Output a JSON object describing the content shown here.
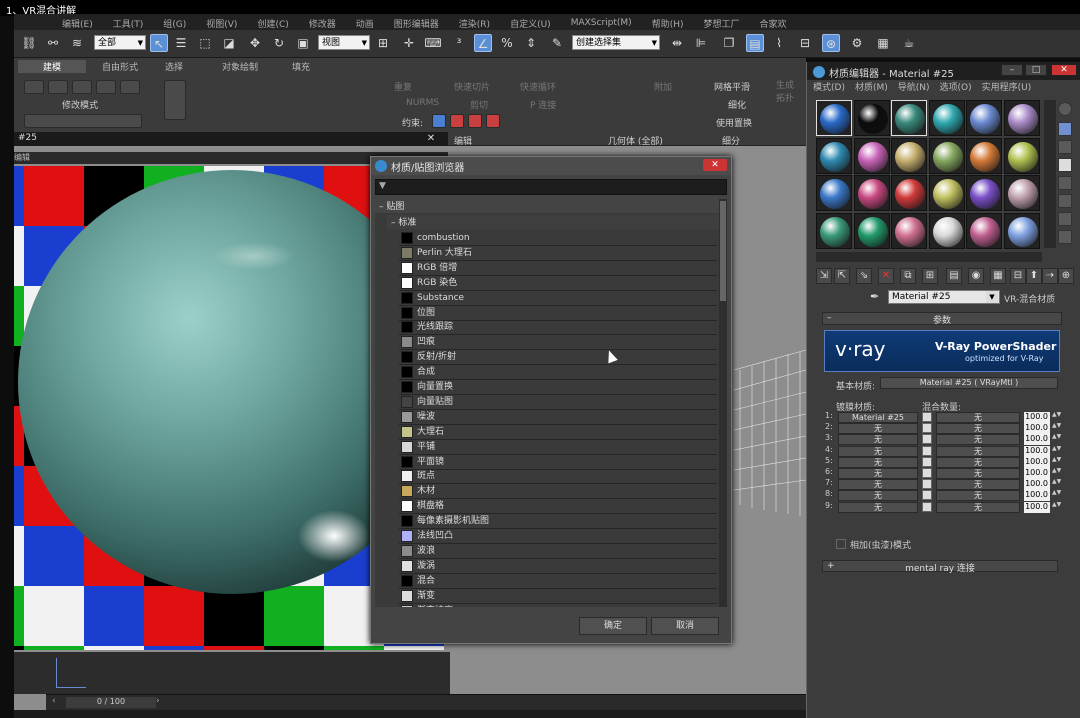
{
  "caption": "1、VR混合讲解",
  "menubar": [
    "编辑(E)",
    "工具(T)",
    "组(G)",
    "视图(V)",
    "创建(C)",
    "修改器",
    "动画",
    "图形编辑器",
    "渲染(R)",
    "自定义(U)",
    "MAXScript(M)",
    "帮助(H)",
    "梦想工厂",
    "合家欢"
  ],
  "toolbar": {
    "filter_select": "全部",
    "view_select": "视图",
    "selection_set": "创建选择集"
  },
  "ribbon": {
    "tabs": [
      "建模",
      "自由形式",
      "选择",
      "对象绘制",
      "填充"
    ],
    "modify_mode": "修改模式",
    "poly_labels": [
      "重复",
      "快速切片",
      "快速循环",
      "附加",
      "网格平滑"
    ],
    "nurms": "NURMS",
    "cut": "剪切",
    "p_connect": "P 连接",
    "constraint": "约束:",
    "geometry_all": "几何体 (全部)",
    "subdivision": "细分",
    "refine": "细化",
    "use_displace": "使用置换",
    "edit": "编辑",
    "generate_topo": "生成拓扑"
  },
  "viewport": {
    "title": "#25",
    "subtitle": "编辑",
    "time_readout": "0 / 100"
  },
  "checker_colors": [
    "#1a3fd0",
    "#10b020",
    "#e01010",
    "#f2f2f2",
    "#000000"
  ],
  "browser": {
    "title": "材质/贴图浏览器",
    "group": "贴图",
    "subgroup": "标准",
    "items": [
      {
        "name": "combustion",
        "swatch": "#000000"
      },
      {
        "name": "Perlin 大理石",
        "swatch": "#7d7b66"
      },
      {
        "name": "RGB 倍增",
        "swatch": "#ffffff"
      },
      {
        "name": "RGB 染色",
        "swatch": "#ffffff"
      },
      {
        "name": "Substance",
        "swatch": "#000000"
      },
      {
        "name": "位图",
        "swatch": "#000000"
      },
      {
        "name": "光线跟踪",
        "swatch": "#000000"
      },
      {
        "name": "凹痕",
        "swatch": "#8a8a8a"
      },
      {
        "name": "反射/折射",
        "swatch": "#000000"
      },
      {
        "name": "合成",
        "swatch": "#000000"
      },
      {
        "name": "向量置换",
        "swatch": "#000000"
      },
      {
        "name": "向量贴图",
        "swatch": "#444444"
      },
      {
        "name": "噪波",
        "swatch": "#9a9a9a"
      },
      {
        "name": "大理石",
        "swatch": "#c4c48a"
      },
      {
        "name": "平铺",
        "swatch": "#d8d8d8"
      },
      {
        "name": "平面镜",
        "swatch": "#000000"
      },
      {
        "name": "斑点",
        "swatch": "#f0f0f0"
      },
      {
        "name": "木材",
        "swatch": "#c9a85a"
      },
      {
        "name": "棋盘格",
        "swatch": "#ffffff"
      },
      {
        "name": "每像素摄影机贴图",
        "swatch": "#000000"
      },
      {
        "name": "法线凹凸",
        "swatch": "#b0b0ff"
      },
      {
        "name": "波浪",
        "swatch": "#8c8c8c"
      },
      {
        "name": "漩涡",
        "swatch": "#e0e0e0"
      },
      {
        "name": "混合",
        "swatch": "#000000"
      },
      {
        "name": "渐变",
        "swatch": "#dcdcdc"
      },
      {
        "name": "渐变坡度",
        "swatch": "#cccccc"
      }
    ],
    "ok": "确定",
    "cancel": "取消"
  },
  "medit": {
    "title": "材质编辑器 - Material #25",
    "menu": [
      "模式(D)",
      "材质(M)",
      "导航(N)",
      "选项(O)",
      "实用程序(U)"
    ],
    "slots": [
      "#2a6ac9",
      "#0c0c0c",
      "#3a8a7c",
      "#2fa8b0",
      "#6a8ad0",
      "#a98bc8",
      "#2f8ab0",
      "#c964b8",
      "#c8b070",
      "#86a860",
      "#d47a38",
      "#b0c050",
      "#3a78c8",
      "#c84880",
      "#d03a3a",
      "#c0c060",
      "#7a50c8",
      "#c0a0b0",
      "#3a9a7a",
      "#229a6a",
      "#d07090",
      "#d8d8d8",
      "#c06090",
      "#7ea0e0"
    ],
    "material_name": "Material #25",
    "material_type": "VR-混合材质",
    "params_label": "参数",
    "vray_brand": "v·ray",
    "vray_product": "V-Ray PowerShader",
    "vray_tagline": "optimized for V-Ray",
    "base_label": "基本材质:",
    "base_value": "Material #25 ( VRayMtl )",
    "coat_label": "镀膜材质:",
    "blend_label": "混合数量:",
    "rows": [
      {
        "idx": "1:",
        "coat": "Material #25",
        "blend": "无",
        "amount": "100.0"
      },
      {
        "idx": "2:",
        "coat": "无",
        "blend": "无",
        "amount": "100.0"
      },
      {
        "idx": "3:",
        "coat": "无",
        "blend": "无",
        "amount": "100.0"
      },
      {
        "idx": "4:",
        "coat": "无",
        "blend": "无",
        "amount": "100.0"
      },
      {
        "idx": "5:",
        "coat": "无",
        "blend": "无",
        "amount": "100.0"
      },
      {
        "idx": "6:",
        "coat": "无",
        "blend": "无",
        "amount": "100.0"
      },
      {
        "idx": "7:",
        "coat": "无",
        "blend": "无",
        "amount": "100.0"
      },
      {
        "idx": "8:",
        "coat": "无",
        "blend": "无",
        "amount": "100.0"
      },
      {
        "idx": "9:",
        "coat": "无",
        "blend": "无",
        "amount": "100.0"
      }
    ],
    "additive_label": "相加(虫漆)模式",
    "mental_ray": "mental ray 连接"
  }
}
